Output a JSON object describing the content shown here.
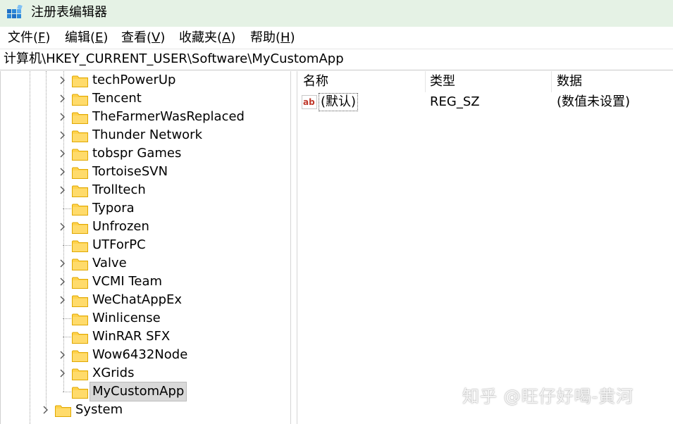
{
  "window": {
    "title": "注册表编辑器"
  },
  "menu": [
    {
      "label": "文件(",
      "key": "F",
      "suffix": ")"
    },
    {
      "label": "编辑(",
      "key": "E",
      "suffix": ")"
    },
    {
      "label": "查看(",
      "key": "V",
      "suffix": ")"
    },
    {
      "label": "收藏夹(",
      "key": "A",
      "suffix": ")"
    },
    {
      "label": "帮助(",
      "key": "H",
      "suffix": ")"
    }
  ],
  "address": "计算机\\HKEY_CURRENT_USER\\Software\\MyCustomApp",
  "tree": {
    "nodes": [
      {
        "label": "techPowerUp",
        "expandable": true
      },
      {
        "label": "Tencent",
        "expandable": true
      },
      {
        "label": "TheFarmerWasReplaced",
        "expandable": true
      },
      {
        "label": "Thunder Network",
        "expandable": true
      },
      {
        "label": "tobspr Games",
        "expandable": true
      },
      {
        "label": "TortoiseSVN",
        "expandable": true
      },
      {
        "label": "Trolltech",
        "expandable": true
      },
      {
        "label": "Typora",
        "expandable": false
      },
      {
        "label": "Unfrozen",
        "expandable": true
      },
      {
        "label": "UTForPC",
        "expandable": false
      },
      {
        "label": "Valve",
        "expandable": true
      },
      {
        "label": "VCMI Team",
        "expandable": true
      },
      {
        "label": "WeChatAppEx",
        "expandable": true
      },
      {
        "label": "Winlicense",
        "expandable": false
      },
      {
        "label": "WinRAR SFX",
        "expandable": false
      },
      {
        "label": "Wow6432Node",
        "expandable": true
      },
      {
        "label": "XGrids",
        "expandable": true
      },
      {
        "label": "MyCustomApp",
        "expandable": false,
        "selected": true
      }
    ],
    "parent_sibling": {
      "label": "System",
      "expandable": true
    }
  },
  "list": {
    "columns": [
      "名称",
      "类型",
      "数据"
    ],
    "rows": [
      {
        "name": "(默认)",
        "type": "REG_SZ",
        "data": "(数值未设置)",
        "icon": "string-value-icon"
      }
    ]
  },
  "watermark": "知乎 @旺仔好喝-黄河",
  "colors": {
    "titlebar": "#e5f2e5",
    "folder": "#ffd24d",
    "selection": "#d9d9d9"
  }
}
